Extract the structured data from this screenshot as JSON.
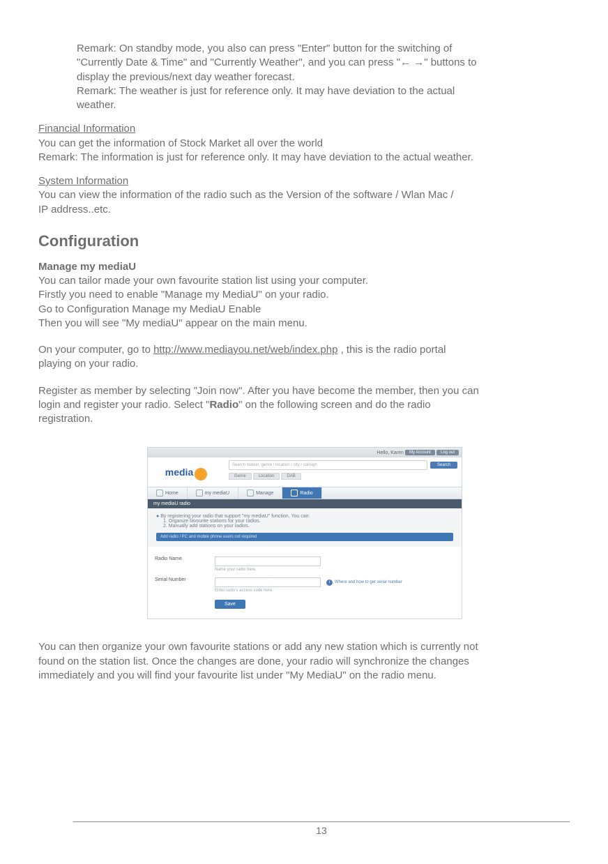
{
  "remark1_l1": "Remark: On standby mode, you also can press \"Enter\" button for the switching of",
  "remark1_l2": "\"Currently Date & Time\" and \"Currently Weather\", and you can press \"← →\" buttons to",
  "remark1_l3": "display the previous/next day weather forecast.",
  "remark1_l4": "Remark: The weather is just for reference only. It may have deviation to the actual",
  "remark1_l5": "weather.",
  "finInfo_h": "Financial Information",
  "finInfo_l1": "You can get the information of Stock Market all over the world",
  "finInfo_l2": "Remark: The information is just for reference only. It may have deviation to the actual weather.",
  "sysInfo_h": "System Information",
  "sysInfo_l1": "You can view the information of the radio such as the Version of the software / Wlan Mac /",
  "sysInfo_l2": "IP address..etc.",
  "config_h": "Configuration",
  "manage_h": "Manage my mediaU",
  "manage_l1": "You can tailor made your own favourite station list using your computer.",
  "manage_l2": "Firstly you need to enable \"Manage my MediaU\" on your radio.",
  "manage_l3": "Go to Configuration Manage my MediaU  Enable",
  "manage_l4": "Then you will see \"My mediaU\" appear on the main menu.",
  "oncomp_pre": "On your computer, go to  ",
  "oncomp_link": "http://www.mediayou.net/web/index.php",
  "oncomp_post": " , this is the radio portal",
  "oncomp_l2": "playing on your radio.",
  "reg_l1a": "Register as member by selecting \"Join now\". After you have become the member, then you can",
  "reg_l2a": "login and register your radio. Select \"",
  "reg_bold": "Radio",
  "reg_l2b": "\" on the following screen and do the radio",
  "reg_l3": "registration.",
  "after_l1": "You can then organize your own favourite stations or add any new station which is currently not",
  "after_l2": "found on the station list.  Once the changes are done, your radio will synchronize the changes",
  "after_l3": "immediately and you will find your favourite list under \"My MediaU\" on the radio menu.",
  "pagenum": "13",
  "ss": {
    "hello": "Hello, Karen",
    "top_btn1": "My Account",
    "top_btn2": "Log out",
    "logo_text": "media",
    "search_ph": "Search station, genre / location / city / callsign",
    "search_btn": "Search",
    "mtab1": "Genre",
    "mtab2": "Location",
    "mtab3": "DAB",
    "nav_home": "Home",
    "nav_my": "my mediaU",
    "nav_manage": "Manage",
    "nav_radio": "Radio",
    "bar": "my mediaU radio",
    "intro_l1": "By registering your radio that support \"my mediaU\" function, You can:",
    "intro_l2": "1. Organize favourite stations for your radios.",
    "intro_l3": "2. Manually add stations on your radios.",
    "addbar": "Add radio / PC and mobile phone users not required",
    "lbl_name": "Radio Name",
    "hint_name": "Name your radio here.",
    "lbl_serial": "Serial Number",
    "hint_serial": "Enter radio's access code here.",
    "info": "Where and how to get serial number",
    "save": "Save"
  }
}
